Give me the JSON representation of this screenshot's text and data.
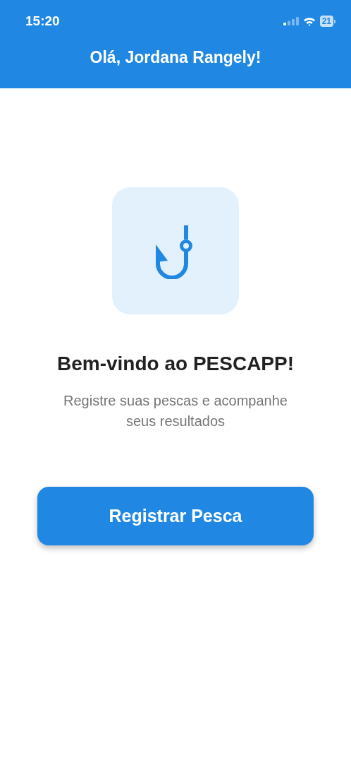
{
  "status_bar": {
    "time": "15:20",
    "battery": "21"
  },
  "header": {
    "title": "Olá, Jordana Rangely!"
  },
  "welcome": {
    "title": "Bem-vindo ao PESCAPP!",
    "subtitle": "Registre suas pescas e acompanhe seus resultados"
  },
  "buttons": [
    "Registrar Pesca"
  ]
}
